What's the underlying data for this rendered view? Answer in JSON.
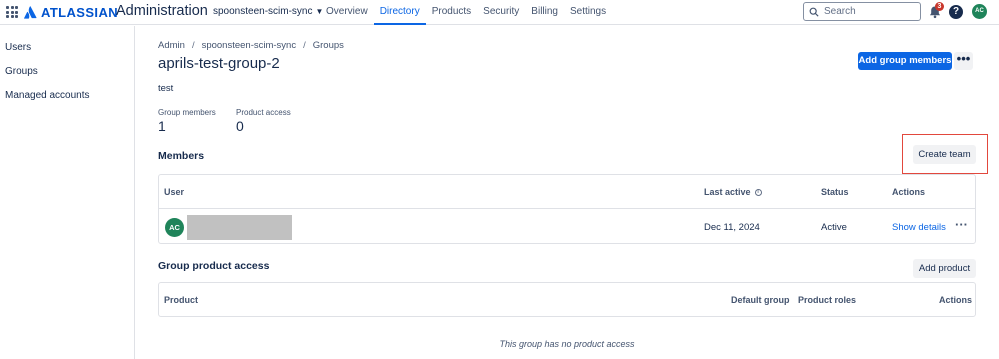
{
  "header": {
    "brand": "ATLASSIAN",
    "product": "Administration",
    "org": "spoonsteen-scim-sync",
    "nav": [
      "Overview",
      "Directory",
      "Products",
      "Security",
      "Billing",
      "Settings"
    ],
    "active_nav": "Directory",
    "search_placeholder": "Search",
    "notification_count": "3",
    "help_label": "?",
    "avatar_initials": "AC"
  },
  "sidebar": {
    "items": [
      "Users",
      "Groups",
      "Managed accounts"
    ]
  },
  "breadcrumb": [
    "Admin",
    "spoonsteen-scim-sync",
    "Groups"
  ],
  "page": {
    "title": "aprils-test-group-2",
    "description": "test",
    "add_members_label": "Add group members",
    "more_label": "•••"
  },
  "stats": {
    "members_label": "Group members",
    "members_value": "1",
    "access_label": "Product access",
    "access_value": "0"
  },
  "members": {
    "title": "Members",
    "create_team_label": "Create team",
    "columns": [
      "User",
      "Last active",
      "Status",
      "Actions"
    ],
    "rows": [
      {
        "initials": "AC",
        "last_active": "Dec 11, 2024",
        "status": "Active",
        "action": "Show details"
      }
    ]
  },
  "product_access": {
    "title": "Group product access",
    "add_label": "Add product",
    "columns": [
      "Product",
      "Default group",
      "Product roles",
      "Actions"
    ],
    "empty": "This group has no product access"
  },
  "colors": {
    "primary": "#0c66e4",
    "avatar": "#1f845a",
    "highlight": "#e2483d"
  }
}
